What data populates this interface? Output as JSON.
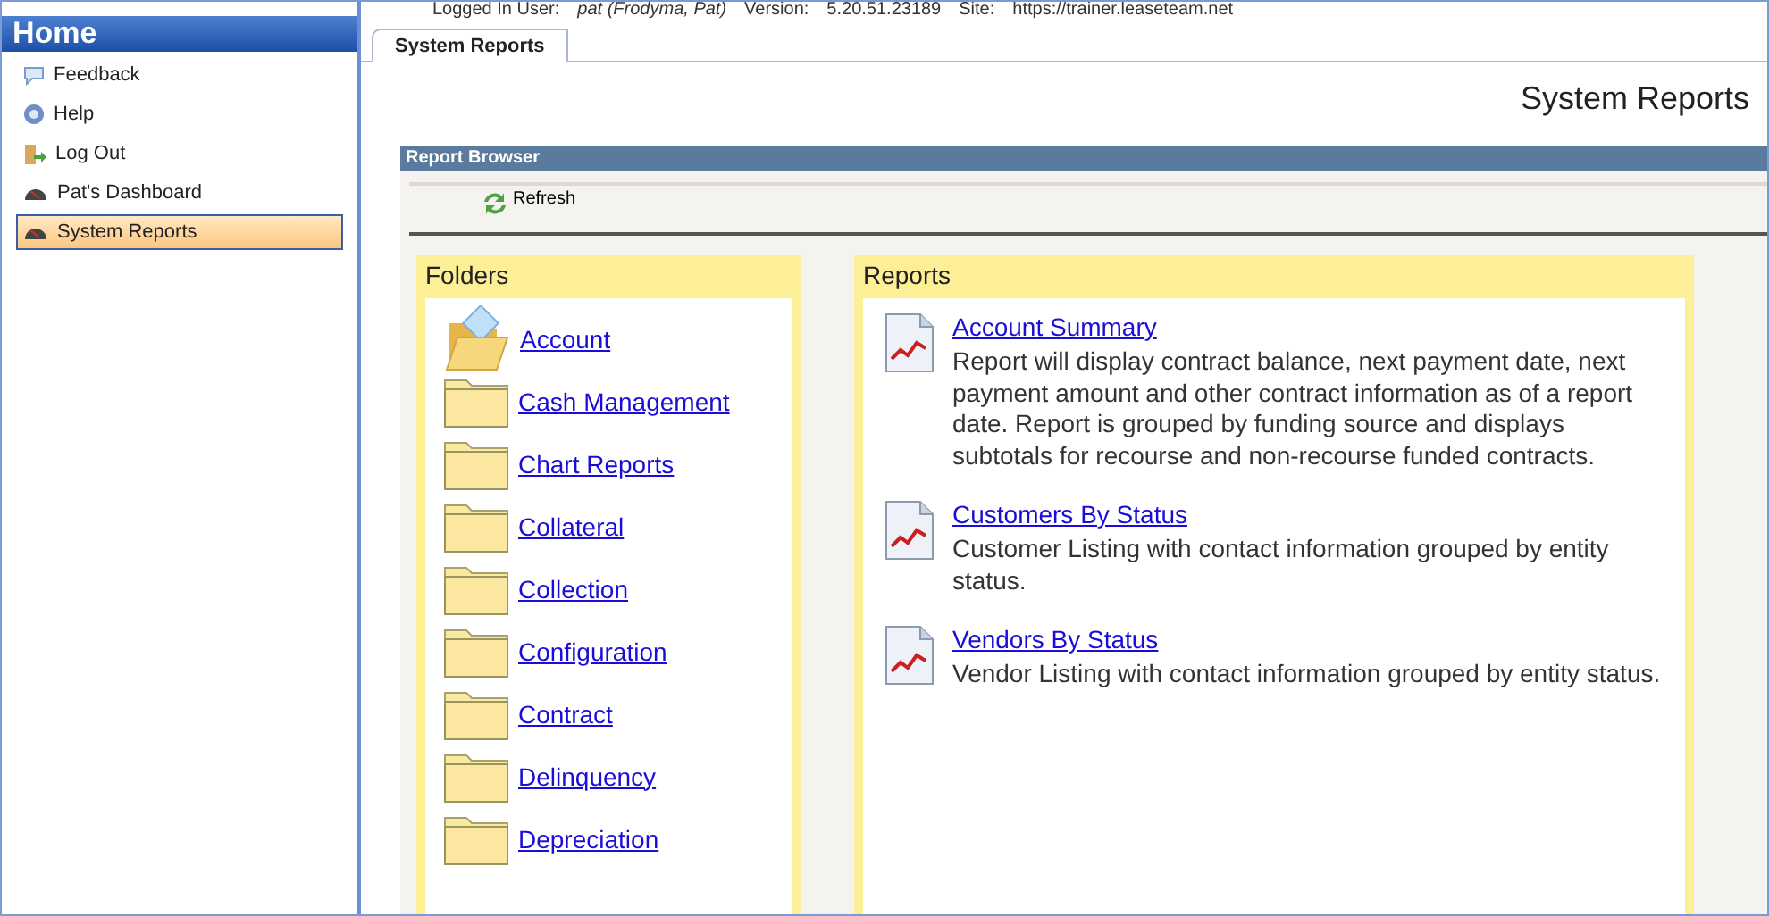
{
  "sidebar": {
    "title": "Home",
    "items": [
      {
        "label": "Feedback",
        "kind": "feedback",
        "selected": false
      },
      {
        "label": "Help",
        "kind": "help",
        "selected": false
      },
      {
        "label": "Log Out",
        "kind": "logout",
        "selected": false
      },
      {
        "label": "Pat's Dashboard",
        "kind": "dashboard",
        "selected": false
      },
      {
        "label": "System Reports",
        "kind": "dashboard",
        "selected": true
      }
    ]
  },
  "session_info": {
    "user_label": "Logged In User:",
    "user": "pat (Frodyma, Pat)",
    "version_label": "Version:",
    "version": "5.20.51.23189",
    "site_label": "Site:",
    "site": "https://trainer.leaseteam.net"
  },
  "tabs": [
    {
      "label": "System Reports",
      "selected": true
    }
  ],
  "page_title": "System Reports",
  "report_browser": {
    "title": "Report Browser",
    "toolbar": [
      {
        "label": "Refresh"
      }
    ],
    "folders": {
      "title": "Folders",
      "items": [
        {
          "label": "Account",
          "open": true
        },
        {
          "label": "Cash Management",
          "open": false
        },
        {
          "label": "Chart Reports",
          "open": false
        },
        {
          "label": "Collateral",
          "open": false
        },
        {
          "label": "Collection",
          "open": false
        },
        {
          "label": "Configuration",
          "open": false
        },
        {
          "label": "Contract",
          "open": false
        },
        {
          "label": "Delinquency",
          "open": false
        },
        {
          "label": "Depreciation",
          "open": false
        }
      ]
    },
    "reports": {
      "title": "Reports",
      "items": [
        {
          "name": "Account Summary",
          "description": "Report will display contract balance, next payment date, next payment amount and other contract information as of a report date. Report is grouped by funding source and displays subtotals for recourse and non-recourse funded contracts."
        },
        {
          "name": "Customers By Status",
          "description": "Customer Listing with contact information grouped by entity status."
        },
        {
          "name": "Vendors By Status",
          "description": "Vendor Listing with contact information grouped by entity status."
        }
      ]
    }
  }
}
